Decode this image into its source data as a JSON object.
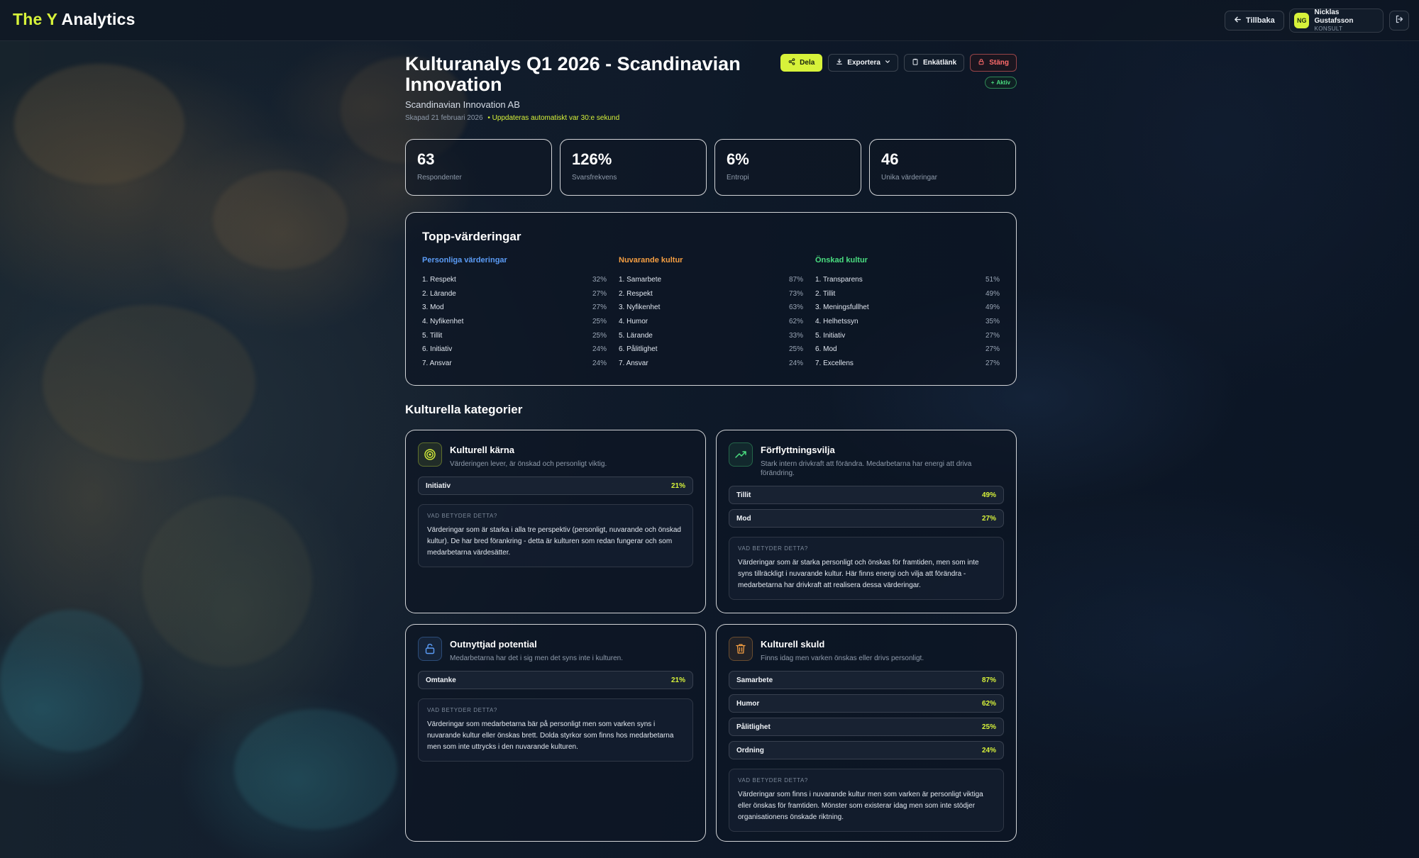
{
  "app": {
    "logo_accent": "The Y",
    "logo_rest": " Analytics",
    "accent_color": "#d7f23a"
  },
  "nav": {
    "back_label": "Tillbaka",
    "user": {
      "initials": "NG",
      "name": "Nicklas Gustafsson",
      "role": "KONSULT"
    }
  },
  "header": {
    "title": "Kulturanalys Q1 2026 - Scandinavian Innovation",
    "company": "Scandinavian Innovation AB",
    "created": "Skapad 21 februari 2026",
    "live_update": "• Uppdateras automatiskt var 30:e sekund",
    "actions": {
      "share": "Dela",
      "export": "Exportera",
      "survey_link": "Enkätlänk",
      "close": "Stäng"
    },
    "status_badge": "Aktiv"
  },
  "stats": [
    {
      "value": "63",
      "label": "Respondenter"
    },
    {
      "value": "126%",
      "label": "Svarsfrekvens"
    },
    {
      "value": "6%",
      "label": "Entropi"
    },
    {
      "value": "46",
      "label": "Unika värderingar"
    }
  ],
  "top_values": {
    "title": "Topp-värderingar",
    "columns": [
      {
        "heading": "Personliga värderingar",
        "color": "#5b9cf6",
        "items": [
          {
            "label": "1. Respekt",
            "pct": "32%"
          },
          {
            "label": "2. Lärande",
            "pct": "27%"
          },
          {
            "label": "3. Mod",
            "pct": "27%"
          },
          {
            "label": "4. Nyfikenhet",
            "pct": "25%"
          },
          {
            "label": "5. Tillit",
            "pct": "25%"
          },
          {
            "label": "6. Initiativ",
            "pct": "24%"
          },
          {
            "label": "7. Ansvar",
            "pct": "24%"
          }
        ]
      },
      {
        "heading": "Nuvarande kultur",
        "color": "#f59e42",
        "items": [
          {
            "label": "1. Samarbete",
            "pct": "87%"
          },
          {
            "label": "2. Respekt",
            "pct": "73%"
          },
          {
            "label": "3. Nyfikenhet",
            "pct": "63%"
          },
          {
            "label": "4. Humor",
            "pct": "62%"
          },
          {
            "label": "5. Lärande",
            "pct": "33%"
          },
          {
            "label": "6. Pålitlighet",
            "pct": "25%"
          },
          {
            "label": "7. Ansvar",
            "pct": "24%"
          }
        ]
      },
      {
        "heading": "Önskad kultur",
        "color": "#4ade80",
        "items": [
          {
            "label": "1. Transparens",
            "pct": "51%"
          },
          {
            "label": "2. Tillit",
            "pct": "49%"
          },
          {
            "label": "3. Meningsfullhet",
            "pct": "49%"
          },
          {
            "label": "4. Helhetssyn",
            "pct": "35%"
          },
          {
            "label": "5. Initiativ",
            "pct": "27%"
          },
          {
            "label": "6. Mod",
            "pct": "27%"
          },
          {
            "label": "7. Excellens",
            "pct": "27%"
          }
        ]
      }
    ]
  },
  "categories": {
    "title": "Kulturella kategorier",
    "explain_heading": "VAD BETYDER DETTA?",
    "items": [
      {
        "name": "Kulturell kärna",
        "icon": "target-icon",
        "icon_color": "#d7f23a",
        "description": "Värderingen lever, är önskad och personligt viktig.",
        "values": [
          {
            "label": "Initiativ",
            "pct": "21%"
          }
        ],
        "explanation": "Värderingar som är starka i alla tre perspektiv (personligt, nuvarande och önskad kultur). De har bred förankring - detta är kulturen som redan fungerar och som medarbetarna värdesätter."
      },
      {
        "name": "Förflyttningsvilja",
        "icon": "trending-up-icon",
        "icon_color": "#4ade80",
        "description": "Stark intern drivkraft att förändra. Medarbetarna har energi att driva förändring.",
        "values": [
          {
            "label": "Tillit",
            "pct": "49%"
          },
          {
            "label": "Mod",
            "pct": "27%"
          }
        ],
        "explanation": "Värderingar som är starka personligt och önskas för framtiden, men som inte syns tillräckligt i nuvarande kultur. Här finns energi och vilja att förändra - medarbetarna har drivkraft att realisera dessa värderingar."
      },
      {
        "name": "Outnyttjad potential",
        "icon": "unlock-icon",
        "icon_color": "#5b9cf6",
        "description": "Medarbetarna har det i sig men det syns inte i kulturen.",
        "values": [
          {
            "label": "Omtanke",
            "pct": "21%"
          }
        ],
        "explanation": "Värderingar som medarbetarna bär på personligt men som varken syns i nuvarande kultur eller önskas brett. Dolda styrkor som finns hos medarbetarna men som inte uttrycks i den nuvarande kulturen."
      },
      {
        "name": "Kulturell skuld",
        "icon": "trash-icon",
        "icon_color": "#f59e42",
        "description": "Finns idag men varken önskas eller drivs personligt.",
        "values": [
          {
            "label": "Samarbete",
            "pct": "87%"
          },
          {
            "label": "Humor",
            "pct": "62%"
          },
          {
            "label": "Pålitlighet",
            "pct": "25%"
          },
          {
            "label": "Ordning",
            "pct": "24%"
          }
        ],
        "explanation": "Värderingar som finns i nuvarande kultur men som varken är personligt viktiga eller önskas för framtiden. Mönster som existerar idag men som inte stödjer organisationens önskade riktning."
      }
    ]
  }
}
